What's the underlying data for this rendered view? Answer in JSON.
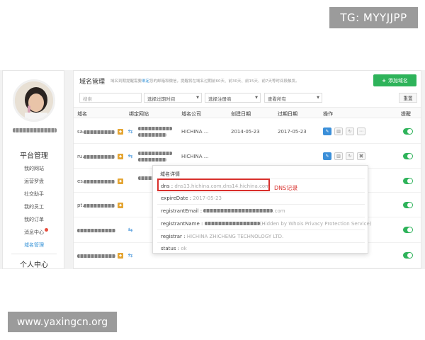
{
  "watermarks": {
    "top": "TG: MYYJJPP",
    "bottom": "www.yaxingcn.org"
  },
  "sidebar": {
    "section1": "平台管理",
    "items": [
      "我的网站",
      "运营罗盘",
      "社交助手",
      "我的员工",
      "我的订单",
      "消息中心",
      "域名管理"
    ],
    "active_index": 6,
    "section2": "个人中心"
  },
  "main": {
    "title": "域名管理",
    "hint_prefix": "域名到期提醒需要",
    "hint_link": "绑定",
    "hint_suffix": "您的邮箱和微信，提醒将在域名过期前60天、前30天、前15天、前7天等时间段触发。",
    "add_button": "添加域名",
    "filters": {
      "search_placeholder": "搜索",
      "expire": "选择过期时间",
      "registrar": "选择注册商",
      "view": "查看所有"
    },
    "reset_button": "重置",
    "columns": [
      "域名",
      "绑定网站",
      "域名公司",
      "创建日期",
      "过期日期",
      "操作",
      "提醒"
    ],
    "rows": [
      {
        "domain": "sa.",
        "company": "HICHINA ...",
        "created": "2014-05-23",
        "expire": "2017-05-23"
      },
      {
        "domain": "ru.",
        "company": "HICHINA ...",
        "created": "",
        "expire": ""
      },
      {
        "domain": "es.",
        "company": "",
        "created": "",
        "expire": ""
      },
      {
        "domain": "pt.",
        "company": "",
        "created": "",
        "expire": ""
      },
      {
        "domain": "",
        "company": "",
        "created": "",
        "expire": ""
      },
      {
        "domain": "",
        "company": "",
        "created": "",
        "expire": ""
      }
    ]
  },
  "popup": {
    "title": "域名详情",
    "dns_label": "dns :",
    "dns_value": "dns13.hichina.com,dns14.hichina.com",
    "expire_label": "expireDate :",
    "expire_value": "2017-05-23",
    "email_label": "registrantEmail :",
    "email_value": ".com",
    "name_label": "registrantName :",
    "name_value": "(Hidden by Whois Privacy Protection Service)",
    "registrar_label": "registrar :",
    "registrar_value": "HICHINA ZHICHENG TECHNOLOGY LTD.",
    "status_label": "status :",
    "status_value": "ok"
  },
  "annotation": "DNS记录",
  "colors": {
    "accent": "#2f8fd6",
    "add": "#2eb35a",
    "highlight": "#d9302c"
  }
}
